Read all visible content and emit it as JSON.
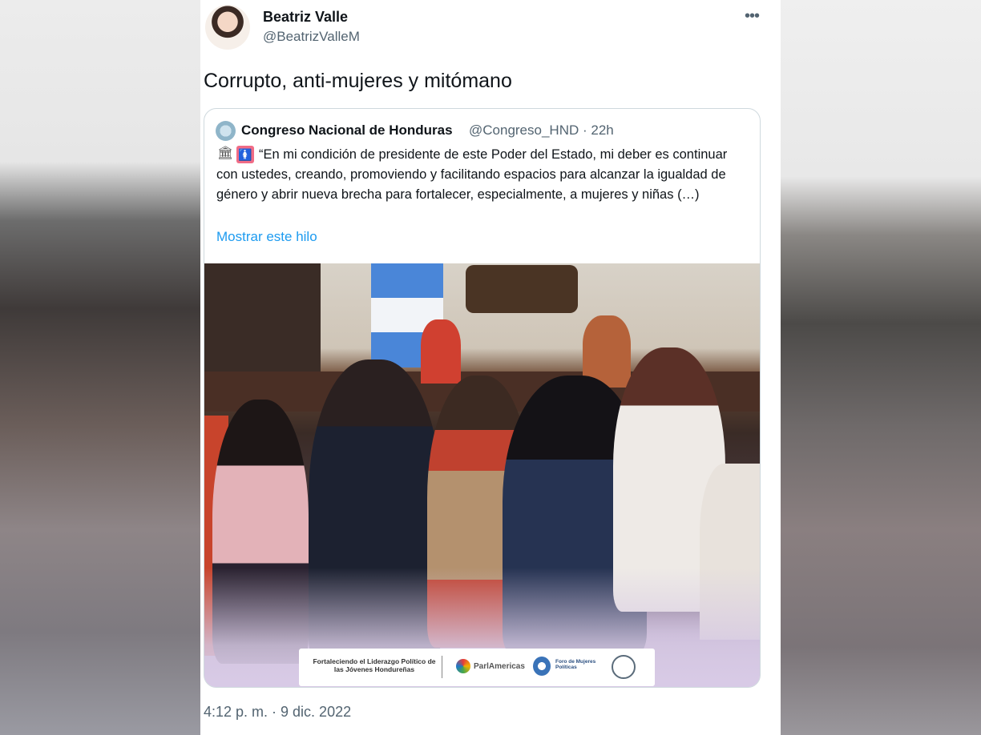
{
  "tweet": {
    "author_name": "Beatriz Valle",
    "author_handle": "@BeatrizValleM",
    "more_icon": "more-horizontal-icon",
    "text": "Corrupto, anti-mujeres y mitómano",
    "timestamp": "4:12 p. m. · 9 dic. 2022"
  },
  "quoted_tweet": {
    "author_name": "Congreso Nacional de Honduras",
    "author_handle": "@Congreso_HND · 22h",
    "emoji_1": "🏛",
    "emoji_2": "🚺",
    "body": "“En mi condición de presidente de este Poder del Estado, mi deber es continuar con ustedes, creando, promoviendo y facilitando espacios para alcanzar la igualdad de género y abrir nueva brecha para fortalecer, especialmente, a mujeres y niñas (…)",
    "show_thread_link": "Mostrar este hilo",
    "image": {
      "banner_text": "Fortaleciendo el Liderazgo Político de las Jóvenes Hondureñas",
      "banner_logo_1": "ParlAmericas",
      "banner_logo_2": "Foro de Mujeres Políticas"
    }
  },
  "colors": {
    "link": "#1d9bf0",
    "secondary_text": "#536471",
    "primary_text": "#0f1419"
  }
}
